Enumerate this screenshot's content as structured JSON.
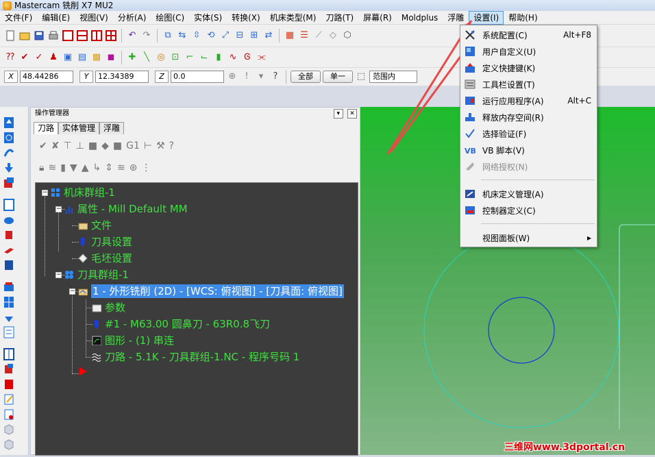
{
  "window": {
    "title": "Mastercam 铣削 X7 MU2"
  },
  "menubar": {
    "items": [
      "文件(F)",
      "编辑(E)",
      "视图(V)",
      "分析(A)",
      "绘图(C)",
      "实体(S)",
      "转换(X)",
      "机床类型(M)",
      "刀路(T)",
      "屏幕(R)",
      "Moldplus",
      "浮雕",
      "设置(I)",
      "帮助(H)"
    ],
    "active": "设置(I)"
  },
  "coords": {
    "x_label": "X",
    "x_value": "48.44286",
    "y_label": "Y",
    "y_value": "12.34389",
    "z_label": "Z",
    "z_value": "0.0"
  },
  "toolbar3": {
    "all_btn": "全部",
    "single_btn": "单一",
    "range_select": "范围内"
  },
  "manager": {
    "title": "操作管理器",
    "tabs": [
      "刀路",
      "实体管理",
      "浮雕"
    ],
    "active_tab": "刀路",
    "tree": {
      "machine_group": "机床群组-1",
      "properties": "属性 - Mill Default MM",
      "files": "文件",
      "tool_settings": "刀具设置",
      "stock_settings": "毛坯设置",
      "tool_group": "刀具群组-1",
      "operation": "1 - 外形铣削 (2D) - [WCS: 俯视图] - [刀具面: 俯视图]",
      "params": "参数",
      "tool": "#1 - M63.00 圆鼻刀 - 63R0.8飞刀",
      "geometry": "图形 - (1) 串连",
      "toolpath": "刀路 - 5.1K - 刀具群组-1.NC - 程序号码 1"
    }
  },
  "settings_menu": {
    "items": [
      {
        "label": "系统配置(C)",
        "shortcut": "Alt+F8",
        "icon": "system-config-icon",
        "enabled": true
      },
      {
        "label": "用户自定义(U)",
        "shortcut": "",
        "icon": "user-define-icon",
        "enabled": true
      },
      {
        "label": "定义快捷键(K)",
        "shortcut": "",
        "icon": "shortcut-key-icon",
        "enabled": true
      },
      {
        "label": "工具栏设置(T)",
        "shortcut": "",
        "icon": "toolbar-settings-icon",
        "enabled": true
      },
      {
        "label": "运行应用程序(A)",
        "shortcut": "Alt+C",
        "icon": "run-app-icon",
        "enabled": true
      },
      {
        "label": "释放内存空间(R)",
        "shortcut": "",
        "icon": "free-memory-icon",
        "enabled": true
      },
      {
        "label": "选择验证(F)",
        "shortcut": "",
        "icon": "select-verify-icon",
        "enabled": true
      },
      {
        "label": "VB 脚本(V)",
        "shortcut": "",
        "icon": "vb-script-icon",
        "enabled": true
      },
      {
        "label": "网络授权(N)",
        "shortcut": "",
        "icon": "network-license-icon",
        "enabled": false
      },
      {
        "label": "机床定义管理(A)",
        "shortcut": "",
        "icon": "machine-def-icon",
        "enabled": true
      },
      {
        "label": "控制器定义(C)",
        "shortcut": "",
        "icon": "controller-def-icon",
        "enabled": true
      },
      {
        "label": "视图面板(W)",
        "shortcut": "",
        "icon": "view-panel-icon",
        "enabled": true
      }
    ]
  },
  "watermark": "三维网www.3dportal.cn",
  "colors": {
    "viewport_green": "#1dbb2c",
    "tree_text": "#3ee23e",
    "tree_bg": "#3c3c3c",
    "selection": "#3f8be8"
  }
}
